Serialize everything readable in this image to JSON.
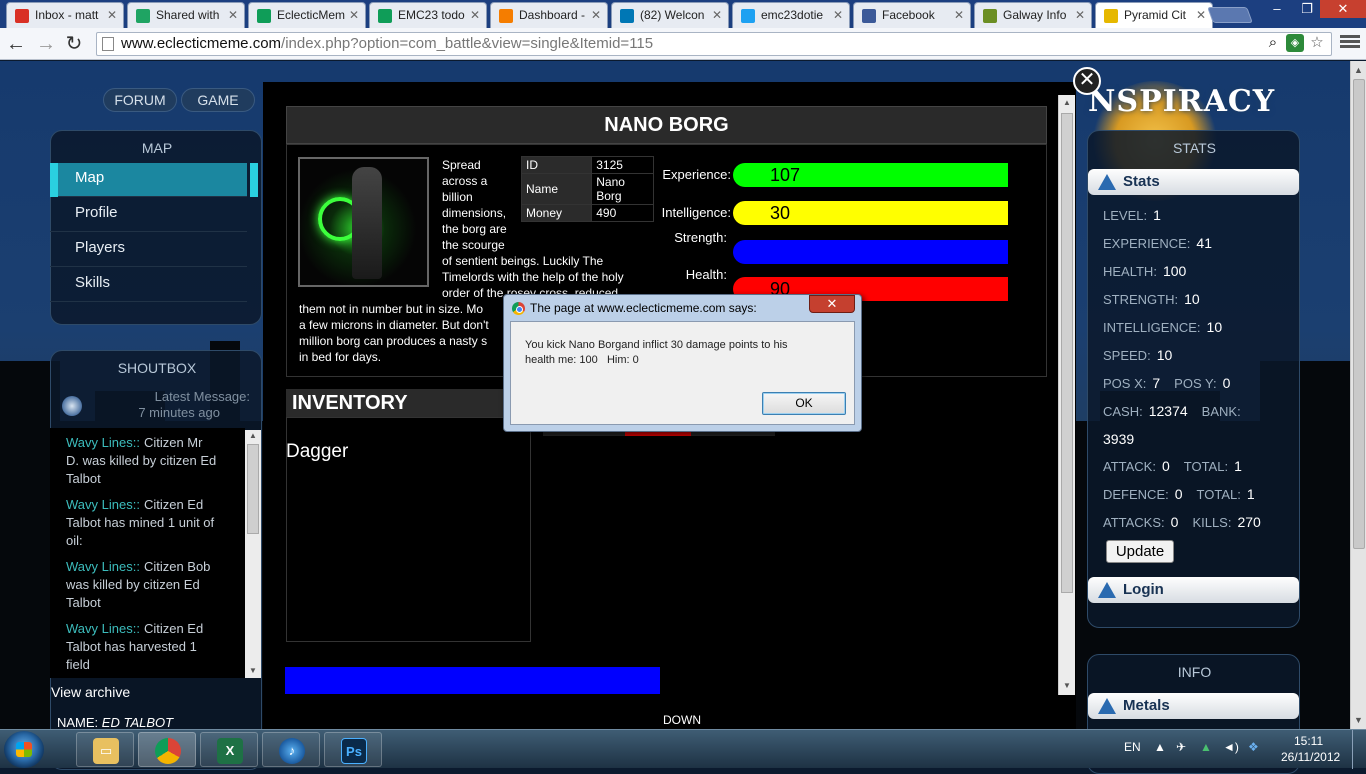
{
  "browser": {
    "tabs": [
      {
        "label": "Inbox - matt",
        "icon": "gmail-icon",
        "color": "#d93025"
      },
      {
        "label": "Shared with",
        "icon": "drive-icon",
        "color": "#1fa463"
      },
      {
        "label": "EclecticMem",
        "icon": "sheets-icon",
        "color": "#0f9d58"
      },
      {
        "label": "EMC23 todo",
        "icon": "sheets-icon",
        "color": "#0f9d58"
      },
      {
        "label": "Dashboard -",
        "icon": "blogger-icon",
        "color": "#f57d00"
      },
      {
        "label": "(82) Welcon",
        "icon": "linkedin-icon",
        "color": "#0077b5"
      },
      {
        "label": "emc23dotie",
        "icon": "twitter-icon",
        "color": "#1da1f2"
      },
      {
        "label": "Facebook",
        "icon": "facebook-icon",
        "color": "#3b5998"
      },
      {
        "label": "Galway Info",
        "icon": "galway-icon",
        "color": "#6b8e23"
      },
      {
        "label": "Pyramid Cit",
        "icon": "pyramid-icon",
        "color": "#e6b800"
      }
    ],
    "url_host": "www.eclecticmeme.com",
    "url_path": "/index.php?option=com_battle&view=single&Itemid=115"
  },
  "topnav": {
    "forum": "FORUM",
    "game": "GAME"
  },
  "map_panel": {
    "title": "MAP",
    "items": [
      "Map",
      "Profile",
      "Players",
      "Skills"
    ]
  },
  "shoutbox": {
    "title": "SHOUTBOX",
    "latest_label": "Latest Message:",
    "latest_time": "7 minutes ago",
    "messages": [
      {
        "who": "Wavy Lines::",
        "lines": [
          "Citizen Mr",
          "D. was killed by citizen Ed",
          "Talbot"
        ]
      },
      {
        "who": "Wavy Lines::",
        "lines": [
          "Citizen Ed",
          "Talbot has mined 1 unit of",
          "oil:"
        ]
      },
      {
        "who": "Wavy Lines::",
        "lines": [
          "Citizen Bob",
          "was killed by citizen Ed",
          "Talbot"
        ]
      },
      {
        "who": "Wavy Lines::",
        "lines": [
          "Citizen Ed",
          "Talbot has harvested 1",
          "field"
        ]
      }
    ],
    "archive": "View archive",
    "name_label": "NAME:",
    "name_value": "ED TALBOT"
  },
  "battle": {
    "title": "NANO BORG",
    "description_lines": [
      "Spread",
      "across a",
      "billion",
      "dimensions,",
      "the borg are",
      "the scourge",
      "of sentient beings. Luckily The",
      "Timelords with the help of the holy",
      "order of the rosey cross, reduced",
      "them not in number but in size. Mo",
      "a few microns in diameter. But don't",
      "million borg can produces a nasty s",
      "in bed for days."
    ],
    "info": [
      {
        "key": "ID",
        "value": "3125"
      },
      {
        "key": "Name",
        "value": "Nano Borg"
      },
      {
        "key": "Money",
        "value": "490"
      }
    ],
    "stats": [
      {
        "label": "Experience:",
        "value": "107",
        "color": "#00ff00"
      },
      {
        "label": "Intelligence:",
        "value": "30",
        "color": "#ffff00"
      },
      {
        "label": "Strength:",
        "value": "",
        "color": "#0000ff"
      },
      {
        "label": "Health:",
        "value": "90",
        "color": "#ff0000"
      }
    ],
    "inventory_title": "INVENTORY",
    "inventory_items": [
      "Dagger"
    ],
    "down_label": "DOWN"
  },
  "right": {
    "logo": "NSPIRACY",
    "stats_title": "STATS",
    "stats_header": "Stats",
    "rows": [
      {
        "pairs": [
          [
            "LEVEL:",
            "1"
          ]
        ]
      },
      {
        "pairs": [
          [
            "EXPERIENCE:",
            "41"
          ]
        ]
      },
      {
        "pairs": [
          [
            "HEALTH:",
            "100"
          ]
        ]
      },
      {
        "pairs": [
          [
            "STRENGTH:",
            "10"
          ]
        ]
      },
      {
        "pairs": [
          [
            "INTELLIGENCE:",
            "10"
          ]
        ]
      },
      {
        "pairs": [
          [
            "SPEED:",
            "10"
          ]
        ]
      },
      {
        "pairs": [
          [
            "POS X:",
            "7"
          ],
          [
            "POS Y:",
            "0"
          ]
        ]
      },
      {
        "pairs": [
          [
            "CASH:",
            "12374"
          ],
          [
            "BANK:",
            ""
          ]
        ]
      },
      {
        "pairs": [
          [
            "",
            "3939"
          ]
        ]
      },
      {
        "pairs": [
          [
            "ATTACK:",
            "0"
          ],
          [
            "TOTAL:",
            "1"
          ]
        ]
      },
      {
        "pairs": [
          [
            "DEFENCE:",
            "0"
          ],
          [
            "TOTAL:",
            "1"
          ]
        ]
      },
      {
        "pairs": [
          [
            "ATTACKS:",
            "0"
          ],
          [
            "KILLS:",
            "270"
          ]
        ]
      }
    ],
    "update_button": "Update",
    "login_header": "Login",
    "info_title": "INFO",
    "metals_header": "Metals"
  },
  "alert": {
    "title": "The page at www.eclecticmeme.com says:",
    "message_line1": "You kick Nano Borgand inflict 30 damage points to his",
    "message_line2": "health me: 100   Him: 0",
    "ok": "OK"
  },
  "taskbar": {
    "apps": [
      "explorer-icon",
      "chrome-icon",
      "excel-icon",
      "itunes-icon",
      "photoshop-icon"
    ],
    "ps_label": "Ps",
    "lang": "EN",
    "time": "15:11",
    "date": "26/11/2012"
  }
}
